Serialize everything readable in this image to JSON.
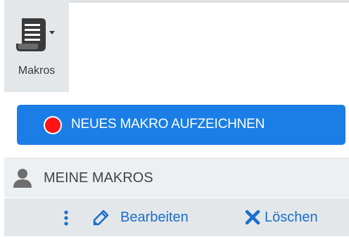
{
  "ribbon": {
    "macros_label": "Makros",
    "macros_icon": "scroll-dropdown-icon"
  },
  "record_button": {
    "label": "NEUES MAKRO AUFZEICHNEN",
    "icon": "record-dot-icon",
    "background_color": "#1a7ee6",
    "dot_color": "#ff1414"
  },
  "my_macros": {
    "title": "MEINE MAKROS",
    "icon": "user-icon"
  },
  "actions": {
    "more_icon": "kebab-menu-icon",
    "edit_label": "Bearbeiten",
    "edit_icon": "pencil-icon",
    "delete_label": "Löschen",
    "delete_icon": "x-icon",
    "link_color": "#1a6fcc"
  }
}
